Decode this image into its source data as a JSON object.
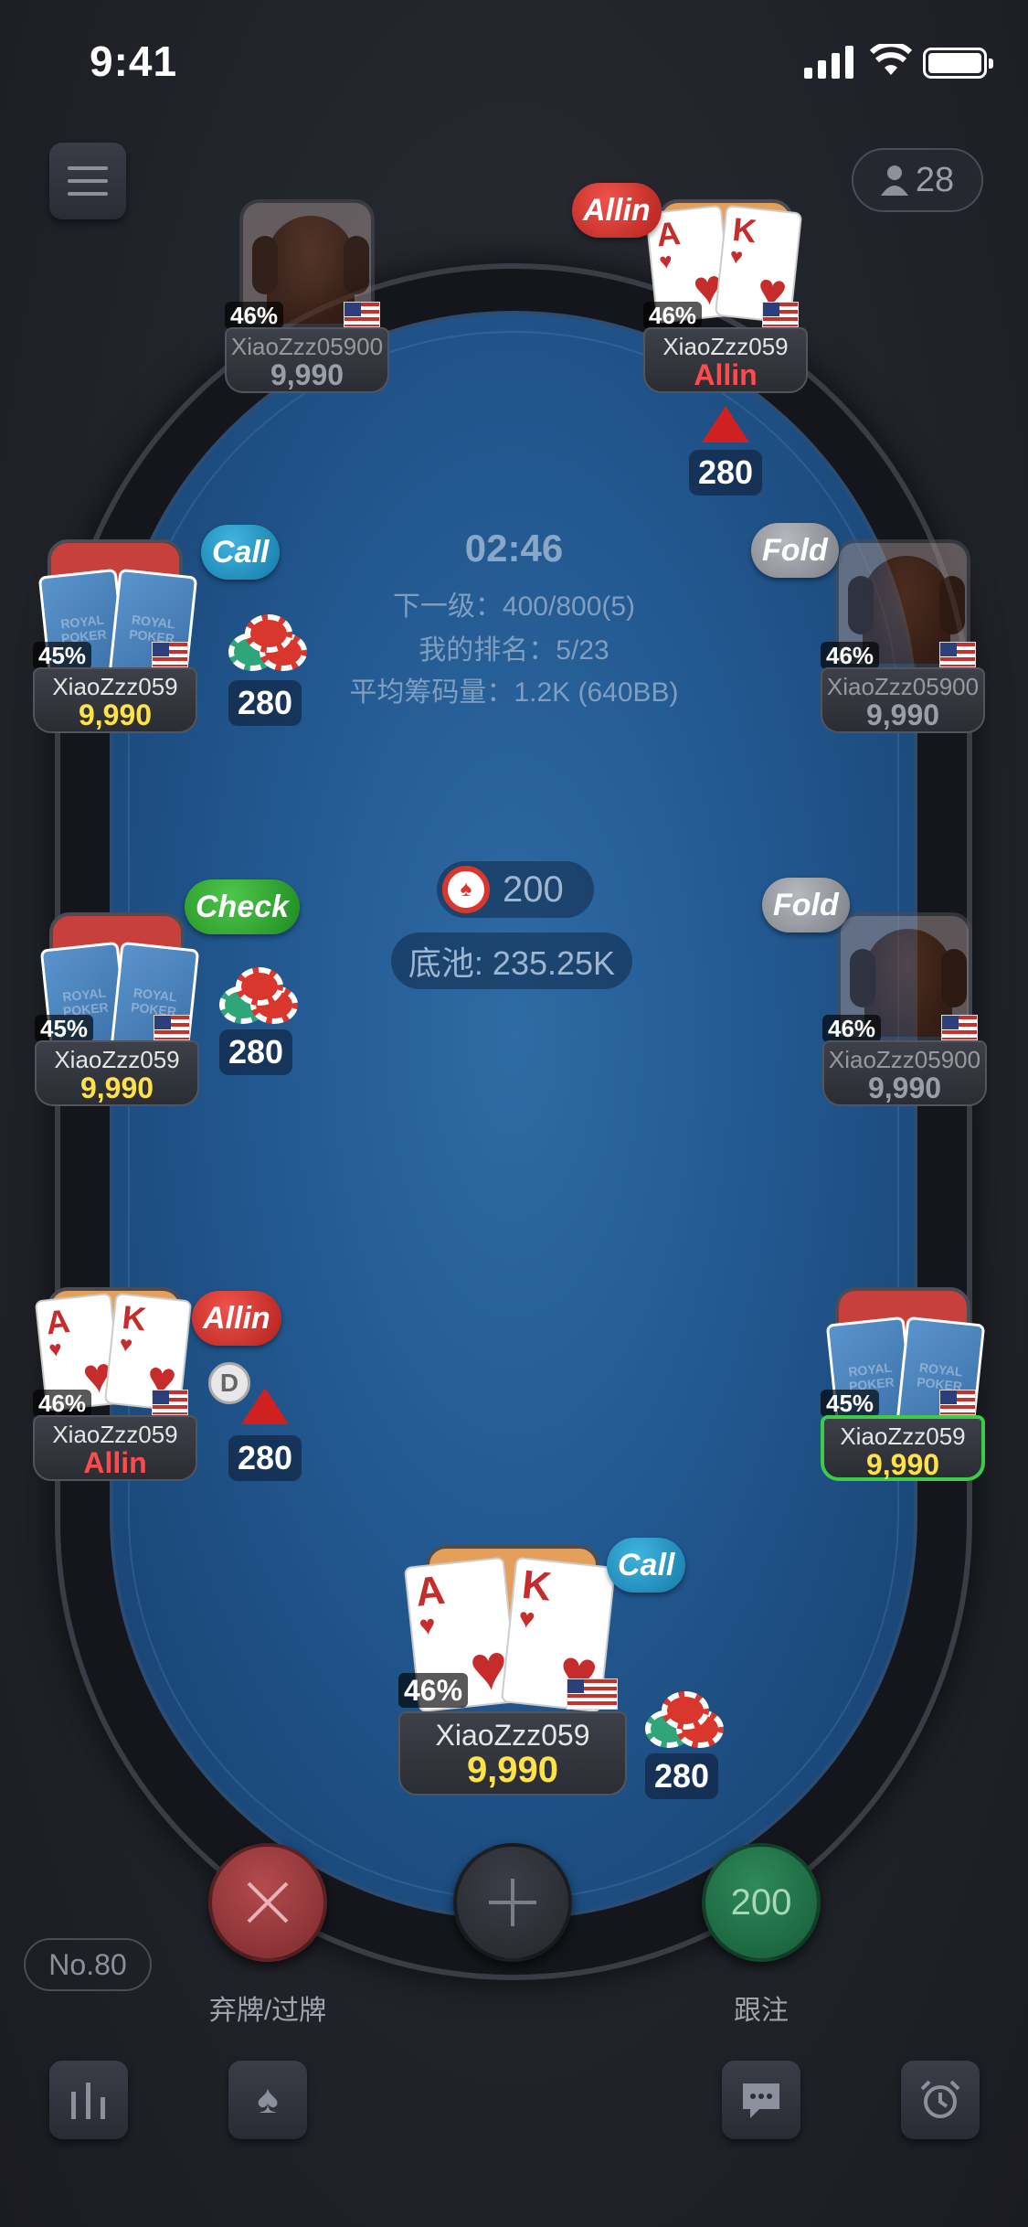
{
  "status": {
    "time": "9:41"
  },
  "header": {
    "online_count": "28"
  },
  "table": {
    "clock": "02:46",
    "next_level": "下一级：400/800(5)",
    "my_rank": "我的排名：5/23",
    "avg_stack": "平均筹码量：1.2K (640BB)",
    "current_bet": "200",
    "pot": "底池: 235.25K"
  },
  "seats": [
    {
      "name": "XiaoZzz05900",
      "stack": "9,990",
      "pct": "46%"
    },
    {
      "name": "XiaoZzz059",
      "stack": "Allin",
      "pct": "46%",
      "cards": [
        "A",
        "K"
      ],
      "bubble": "Allin",
      "bet": "280"
    },
    {
      "name": "XiaoZzz059",
      "stack": "9,990",
      "pct": "45%",
      "bubble": "Call",
      "bet": "280"
    },
    {
      "name": "XiaoZzz05900",
      "stack": "9,990",
      "pct": "46%",
      "bubble": "Fold"
    },
    {
      "name": "XiaoZzz059",
      "stack": "9,990",
      "pct": "45%",
      "bubble": "Check",
      "bet": "280"
    },
    {
      "name": "XiaoZzz05900",
      "stack": "9,990",
      "pct": "46%",
      "bubble": "Fold"
    },
    {
      "name": "XiaoZzz059",
      "stack": "Allin",
      "pct": "46%",
      "cards": [
        "A",
        "K"
      ],
      "bubble": "Allin",
      "bet": "280",
      "dealer": "D"
    },
    {
      "name": "XiaoZzz059",
      "stack": "9,990",
      "pct": "45%"
    },
    {
      "name": "XiaoZzz059",
      "stack": "9,990",
      "pct": "46%",
      "cards": [
        "A",
        "K"
      ],
      "bubble": "Call",
      "bet": "280"
    }
  ],
  "card_back_text": "ROYAL POKER",
  "allin_badge": "Allin",
  "actions": {
    "fold_label": "弃牌/过牌",
    "call_label": "跟注",
    "call_amount": "200"
  },
  "footer": {
    "table_no": "No.80"
  },
  "icons": [
    "menu-icon",
    "user-icon",
    "chart-icon",
    "spade-icon",
    "chat-icon",
    "alarm-clock-icon"
  ],
  "colors": {
    "felt": "#225890",
    "stack": "#ffe14a",
    "allin": "#ff4b4b",
    "active_border": "#3dcc4a"
  }
}
